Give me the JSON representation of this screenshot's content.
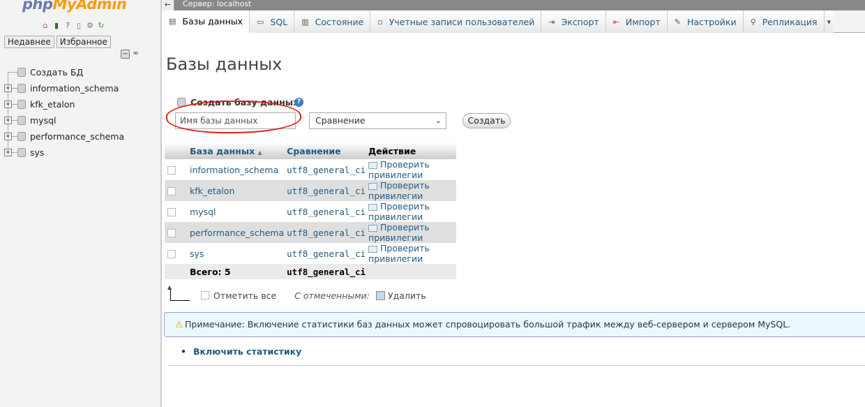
{
  "left": {
    "logo_php": "php",
    "logo_myadmin": "MyAdmin",
    "recent": "Недавнее",
    "favorites": "Избранное",
    "tree": [
      {
        "label": "Создать БД",
        "new": true
      },
      {
        "label": "information_schema"
      },
      {
        "label": "kfk_etalon"
      },
      {
        "label": "mysql"
      },
      {
        "label": "performance_schema"
      },
      {
        "label": "sys"
      }
    ]
  },
  "header": {
    "server": "Сервер: localhost",
    "tabs": [
      {
        "label": "Базы данных",
        "icon": "database-icon"
      },
      {
        "label": "SQL",
        "icon": "sql-icon"
      },
      {
        "label": "Состояние",
        "icon": "status-icon"
      },
      {
        "label": "Учетные записи пользователей",
        "icon": "users-icon"
      },
      {
        "label": "Экспорт",
        "icon": "export-icon"
      },
      {
        "label": "Импорт",
        "icon": "import-icon"
      },
      {
        "label": "Настройки",
        "icon": "wrench-icon"
      },
      {
        "label": "Репликация",
        "icon": "replication-icon"
      }
    ]
  },
  "main": {
    "title": "Базы данных",
    "create_legend": "Создать базу данных",
    "dbname_placeholder": "Имя базы данных",
    "collation_value": "Сравнение",
    "create_button": "Создать",
    "table": {
      "headers": [
        "База данных",
        "Сравнение",
        "Действие"
      ],
      "rows": [
        {
          "name": "information_schema",
          "collation": "utf8_general_ci",
          "action": "Проверить привилегии"
        },
        {
          "name": "kfk_etalon",
          "collation": "utf8_general_ci",
          "action": "Проверить привилегии"
        },
        {
          "name": "mysql",
          "collation": "utf8_general_ci",
          "action": "Проверить привилегии"
        },
        {
          "name": "performance_schema",
          "collation": "utf8_general_ci",
          "action": "Проверить привилегии"
        },
        {
          "name": "sys",
          "collation": "utf8_general_ci",
          "action": "Проверить привилегии"
        }
      ],
      "total_label": "Всего: 5",
      "total_collation": "utf8_general_ci"
    },
    "check_all": "Отметить все",
    "with_selected": "С отмеченными:",
    "drop": "Удалить",
    "notice": "Примечание: Включение статистики баз данных может спровоцировать большой трафик между веб-сервером и сервером MySQL.",
    "enable_stats": "Включить статистику"
  },
  "colors": {
    "link": "#235a81",
    "annotation": "#d21"
  }
}
